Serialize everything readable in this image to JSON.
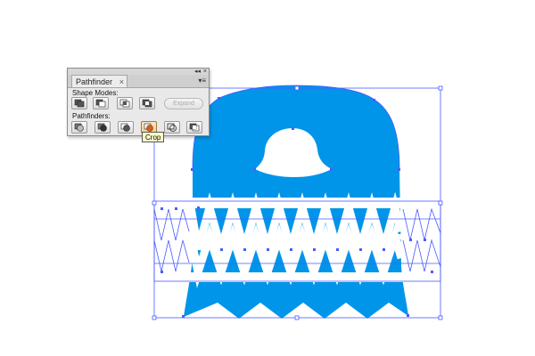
{
  "panel": {
    "tab_title": "Pathfinder",
    "tab_close_glyph": "×",
    "menu_glyph": "▾≡",
    "collapse_glyph": "◂◂",
    "close_glyph": "×",
    "shape_modes_label": "Shape Modes:",
    "shape_mode_buttons": [
      "unite-icon",
      "minus-front-icon",
      "intersect-icon",
      "exclude-icon"
    ],
    "expand_label": "Expand",
    "pathfinders_label": "Pathfinders:",
    "pathfinder_buttons": [
      "divide-icon",
      "trim-icon",
      "merge-icon",
      "crop-icon",
      "outline-icon",
      "minus-back-icon"
    ],
    "active_button": "crop-icon"
  },
  "tooltip": {
    "text": "Crop"
  },
  "colors": {
    "shape_fill": "#0095e8",
    "selection": "#4a5bff",
    "panel_bg": "#e9e9e9",
    "tooltip_bg": "#ffffcc",
    "crop_accent": "#e05a17"
  }
}
